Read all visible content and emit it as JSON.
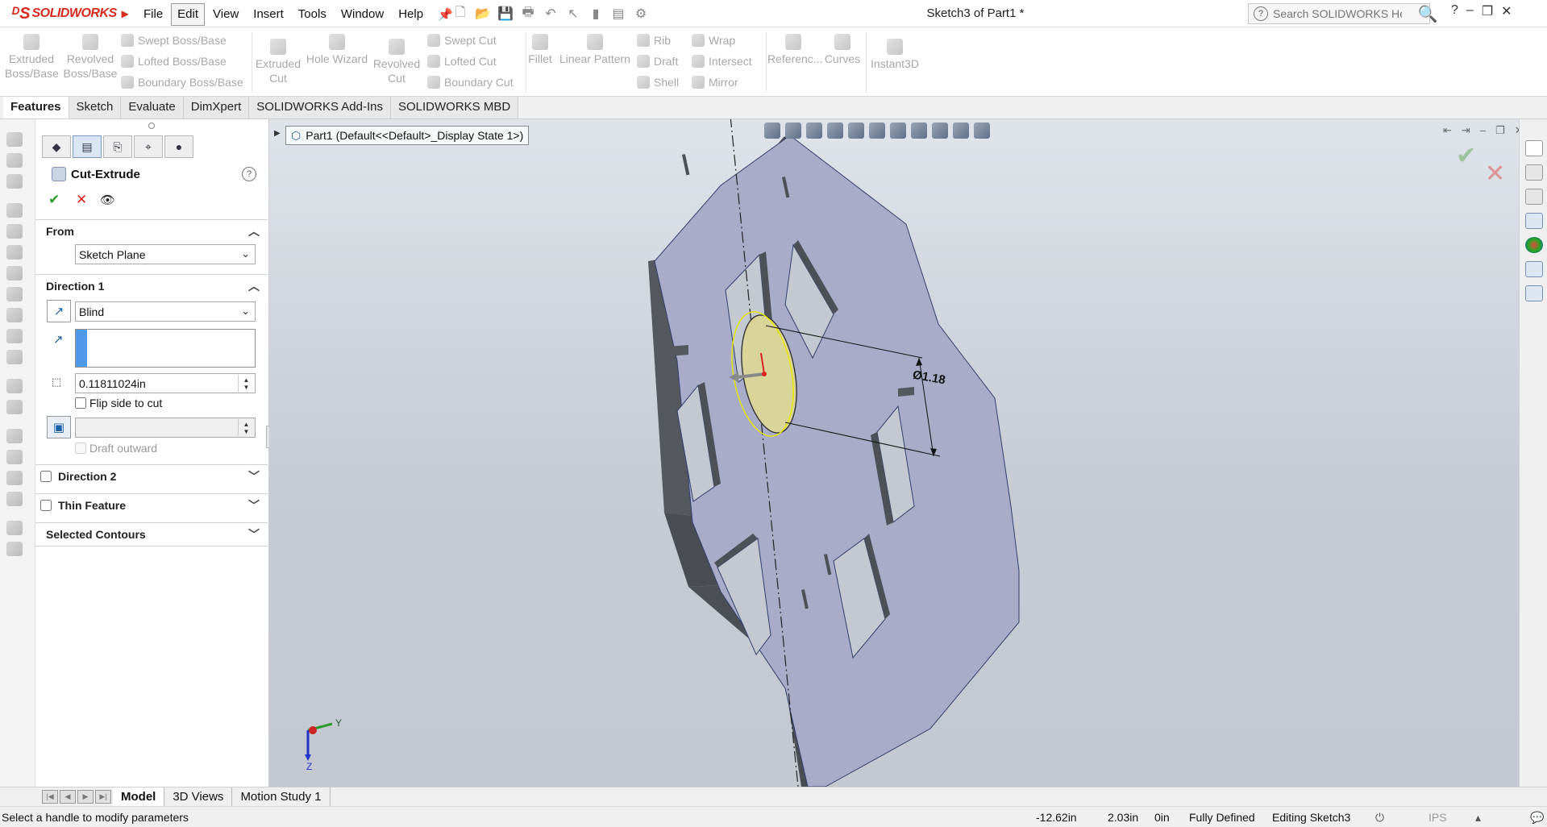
{
  "app": {
    "logo_text": "SOLIDWORKS",
    "document_title": "Sketch3 of Part1 *"
  },
  "menu": {
    "items": [
      "File",
      "Edit",
      "View",
      "Insert",
      "Tools",
      "Window",
      "Help"
    ],
    "active": "Edit"
  },
  "help_search": {
    "placeholder": "Search SOLIDWORKS Help"
  },
  "window_controls": [
    "?",
    "–",
    "❐",
    "✕"
  ],
  "command_manager": {
    "extruded_boss": "Extruded Boss/Base",
    "revolved_boss": "Revolved Boss/Base",
    "swept_boss": "Swept Boss/Base",
    "lofted_boss": "Lofted Boss/Base",
    "boundary_boss": "Boundary Boss/Base",
    "extruded_cut": "Extruded Cut",
    "hole_wizard": "Hole Wizard",
    "revolved_cut": "Revolved Cut",
    "swept_cut": "Swept Cut",
    "lofted_cut": "Lofted Cut",
    "boundary_cut": "Boundary Cut",
    "fillet": "Fillet",
    "linear_pattern": "Linear Pattern",
    "rib": "Rib",
    "draft": "Draft",
    "shell": "Shell",
    "wrap": "Wrap",
    "intersect": "Intersect",
    "mirror": "Mirror",
    "reference": "Referenc...",
    "curves": "Curves",
    "instant3d": "Instant3D"
  },
  "tabs": [
    "Features",
    "Sketch",
    "Evaluate",
    "DimXpert",
    "SOLIDWORKS Add-Ins",
    "SOLIDWORKS MBD"
  ],
  "active_tab": "Features",
  "property_manager": {
    "title": "Cut-Extrude",
    "from": {
      "label": "From",
      "value": "Sketch Plane"
    },
    "direction1": {
      "label": "Direction 1",
      "end_condition": "Blind",
      "depth": "0.11811024in",
      "flip_side_label": "Flip side to cut",
      "flip_side_checked": false,
      "draft_value": "",
      "draft_outward_label": "Draft outward"
    },
    "direction2": {
      "label": "Direction 2",
      "checked": false
    },
    "thin_feature": {
      "label": "Thin Feature",
      "checked": false
    },
    "selected_contours": {
      "label": "Selected Contours"
    }
  },
  "viewport": {
    "tree_flyout": "Part1  (Default<<Default>_Display State 1>)",
    "dimension_text": "Ø1.18",
    "triad": {
      "x": "Y",
      "z": "Z"
    }
  },
  "bottom_tabs": [
    "Model",
    "3D Views",
    "Motion Study 1"
  ],
  "active_bottom_tab": "Model",
  "status": {
    "message": "Select a handle to modify parameters",
    "x": "-12.62in",
    "y": "2.03in",
    "z": "0in",
    "definition": "Fully Defined",
    "editing": "Editing Sketch3",
    "units": "IPS"
  }
}
